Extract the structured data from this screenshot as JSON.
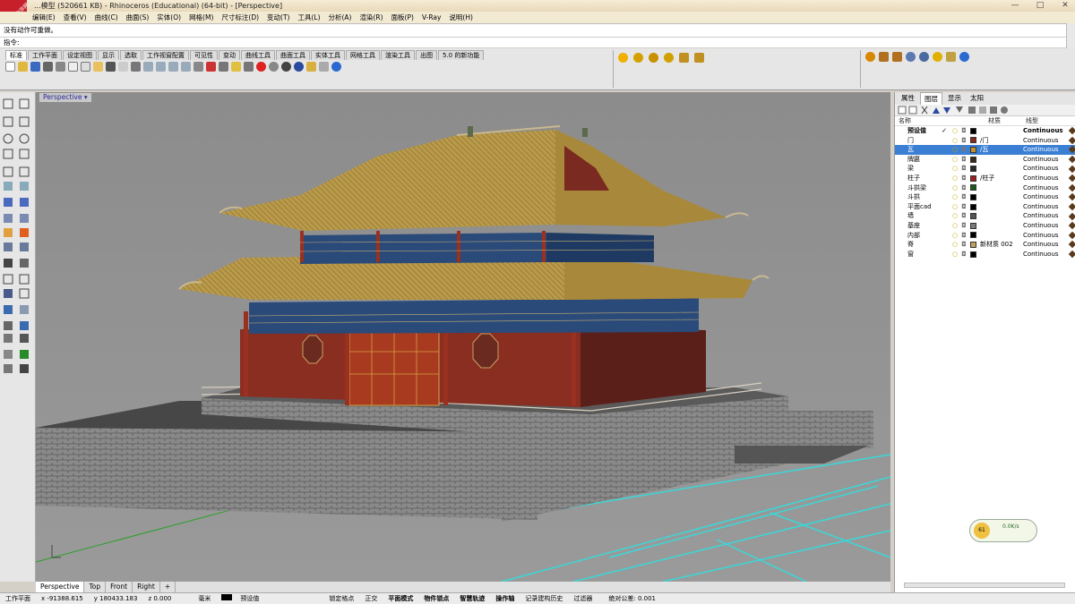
{
  "window": {
    "title": "...模型 (520661 KB) - Rhinoceros (Educational) (64-bit) - [Perspective]",
    "badge": "好看的中华网",
    "controls": [
      "—",
      "□",
      "✕"
    ]
  },
  "menu": [
    "编辑(E)",
    "查看(V)",
    "曲线(C)",
    "曲面(S)",
    "实体(O)",
    "网格(M)",
    "尺寸标注(D)",
    "变动(T)",
    "工具(L)",
    "分析(A)",
    "渲染(R)",
    "面板(P)",
    "V-Ray",
    "说明(H)"
  ],
  "command": {
    "history": "没有动作可重做。",
    "prompt": "指令:"
  },
  "toolbar_tabs": [
    "标准",
    "工作平面",
    "设定视图",
    "显示",
    "选取",
    "工作视窗配置",
    "可见性",
    "变动",
    "曲线工具",
    "曲面工具",
    "实体工具",
    "网格工具",
    "渲染工具",
    "出图",
    "5.0 的新功能"
  ],
  "viewport": {
    "label": "Perspective"
  },
  "viewport_tabs": [
    "Perspective",
    "Top",
    "Front",
    "Right",
    "+"
  ],
  "panel": {
    "tabs": [
      "属性",
      "图层",
      "显示",
      "太阳"
    ],
    "headers": {
      "name": "名称",
      "material": "材质",
      "linetype": "线型"
    },
    "layers": [
      {
        "name": "预设值",
        "check": "✓",
        "material": "",
        "linetype": "Continuous",
        "color": "#000000",
        "bold": true
      },
      {
        "name": "门",
        "check": "",
        "material": "/门",
        "linetype": "Continuous",
        "color": "#8a2a1f"
      },
      {
        "name": "瓦",
        "check": "",
        "material": "/瓦",
        "linetype": "Continuous",
        "color": "#c0922a",
        "selected": true
      },
      {
        "name": "牌匾",
        "check": "",
        "material": "",
        "linetype": "Continuous",
        "color": "#3a2a1a"
      },
      {
        "name": "梁",
        "check": "",
        "material": "",
        "linetype": "Continuous",
        "color": "#2a2a2a"
      },
      {
        "name": "柱子",
        "check": "",
        "material": "/柱子",
        "linetype": "Continuous",
        "color": "#a02020"
      },
      {
        "name": "斗拱梁",
        "check": "",
        "material": "",
        "linetype": "Continuous",
        "color": "#1a5a1a"
      },
      {
        "name": "斗拱",
        "check": "",
        "material": "",
        "linetype": "Continuous",
        "color": "#000000"
      },
      {
        "name": "平面cad",
        "check": "",
        "material": "",
        "linetype": "Continuous",
        "color": "#000000"
      },
      {
        "name": "墙",
        "check": "",
        "material": "",
        "linetype": "Continuous",
        "color": "#555555"
      },
      {
        "name": "基座",
        "check": "",
        "material": "",
        "linetype": "Continuous",
        "color": "#7a7a7a"
      },
      {
        "name": "内部",
        "check": "",
        "material": "",
        "linetype": "Continuous",
        "color": "#000000"
      },
      {
        "name": "脊",
        "check": "",
        "material": "新材质 002",
        "linetype": "Continuous",
        "color": "#c0a060"
      },
      {
        "name": "窗",
        "check": "",
        "material": "",
        "linetype": "Continuous",
        "color": "#000000"
      }
    ]
  },
  "tray": {
    "speed": "0.0K/s",
    "percent": "61"
  },
  "status": {
    "cplane": "工作平面",
    "x": "x -91388.615",
    "y": "y 180433.183",
    "z": "z 0.000",
    "unit": "毫米",
    "layer": "预设值",
    "toggles": [
      "锁定格点",
      "正交",
      "平面模式",
      "物件锁点",
      "智慧轨迹",
      "操作轴",
      "记录建构历史",
      "过滤器"
    ],
    "bold_toggles": [
      "平面模式",
      "物件锁点",
      "智慧轨迹",
      "操作轴"
    ],
    "tolerance": "绝对公差: 0.001"
  }
}
